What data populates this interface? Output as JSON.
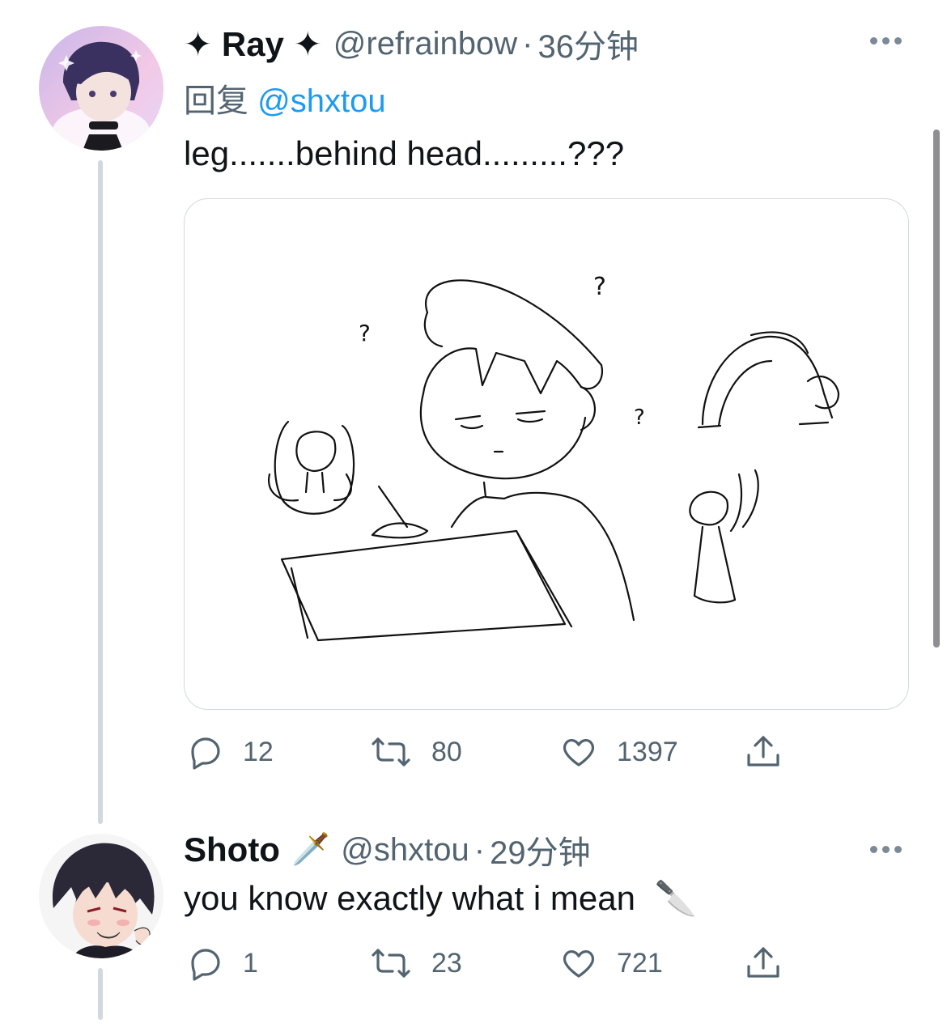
{
  "tweets": [
    {
      "display_name": "✦ Ray ✦",
      "handle": "@refrainbow",
      "sep": "·",
      "time": "36分钟",
      "reply_prefix": "回复",
      "reply_to": "@shxtou",
      "text": "leg.......behind head.........???",
      "actions": {
        "replies": "12",
        "retweets": "80",
        "likes": "1397"
      }
    },
    {
      "display_name": "Shoto",
      "name_emoji": "🗡️",
      "handle": "@shxtou",
      "sep": "·",
      "time": "29分钟",
      "text": "you know exactly what i mean",
      "text_emoji": "🔪",
      "actions": {
        "replies": "1",
        "retweets": "23",
        "likes": "721"
      }
    }
  ],
  "icons": {
    "more": "more-horizontal-icon",
    "reply": "reply-icon",
    "retweet": "retweet-icon",
    "like": "heart-icon",
    "share": "share-icon"
  },
  "colors": {
    "link": "#1d9bf0",
    "muted": "#536471",
    "text": "#0f1419",
    "thread_line": "#cfd9de"
  }
}
